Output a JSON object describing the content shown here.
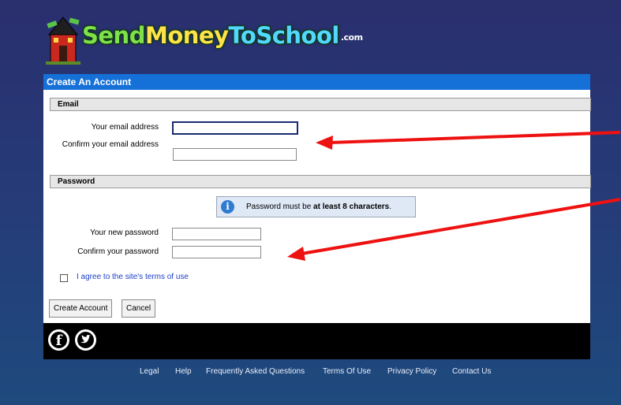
{
  "logo": {
    "part1": "Send",
    "part2": "Money",
    "part3": "ToSchool",
    "suffix": ".com",
    "icon": "school-building-icon"
  },
  "panel": {
    "title": "Create An Account"
  },
  "email_section": {
    "header": "Email",
    "email_label": "Your email address",
    "confirm_label": "Confirm your email address",
    "email_value": "",
    "confirm_value": ""
  },
  "password_section": {
    "header": "Password",
    "info_icon": "info-icon",
    "info_prefix": "Password must be ",
    "info_bold": "at least 8 characters",
    "info_suffix": ".",
    "new_label": "Your new password",
    "confirm_label": "Confirm your password",
    "new_value": "",
    "confirm_value": ""
  },
  "terms": {
    "label": "I agree to the site's terms of use",
    "checked": false
  },
  "buttons": {
    "create": "Create Account",
    "cancel": "Cancel"
  },
  "social": [
    {
      "name": "facebook-icon",
      "glyph": "f"
    },
    {
      "name": "twitter-icon"
    }
  ],
  "footer": {
    "links": [
      "Legal",
      "Help",
      "Frequently Asked Questions",
      "Terms Of Use",
      "Privacy Policy",
      "Contact Us"
    ]
  },
  "colors": {
    "header_blue": "#1570d8",
    "background": "#263a78",
    "arrow": "#ee1111",
    "link": "#1a3ec8"
  }
}
